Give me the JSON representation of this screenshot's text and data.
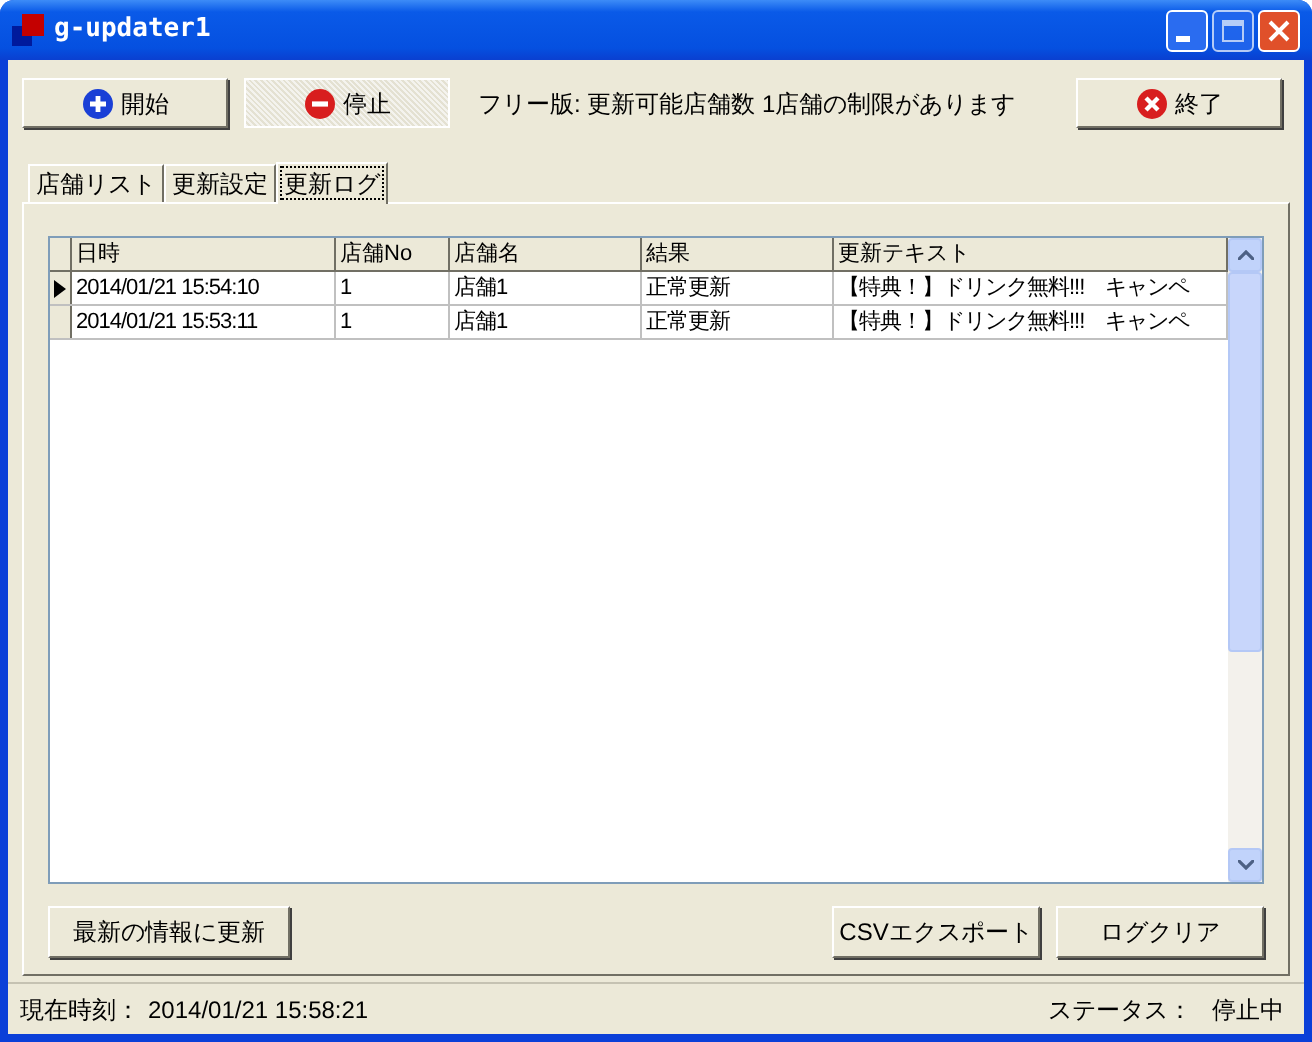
{
  "window": {
    "title": "g-updater1"
  },
  "toolbar": {
    "buttons": [
      {
        "label": "開始",
        "kind": "start",
        "pressed": false
      },
      {
        "label": "停止",
        "kind": "stop",
        "pressed": true
      }
    ],
    "notice": "フリー版: 更新可能店舗数 1店舗の制限があります",
    "exit_button": {
      "label": "終了"
    }
  },
  "tabs": [
    {
      "label": "店舗リスト",
      "selected": false
    },
    {
      "label": "更新設定",
      "selected": false
    },
    {
      "label": "更新ログ",
      "selected": true
    }
  ],
  "table": {
    "columns": [
      "日時",
      "店舗No",
      "店舗名",
      "結果",
      "更新テキスト"
    ],
    "rows": [
      {
        "selected": true,
        "cells": [
          "2014/01/21 15:54:10",
          "1",
          "店舗1",
          "正常更新",
          "【特典！】ドリンク無料!!!　キャンペ"
        ]
      },
      {
        "selected": false,
        "cells": [
          "2014/01/21 15:53:11",
          "1",
          "店舗1",
          "正常更新",
          "【特典！】ドリンク無料!!!　キャンペ"
        ]
      }
    ]
  },
  "actions": {
    "refresh": "最新の情報に更新",
    "export": "CSVエクスポート",
    "clear": "ログクリア"
  },
  "status_bar": {
    "time_label": "現在時刻：",
    "time": "2014/01/21 15:58:21",
    "status_label": "ステータス：",
    "status": "停止中"
  }
}
